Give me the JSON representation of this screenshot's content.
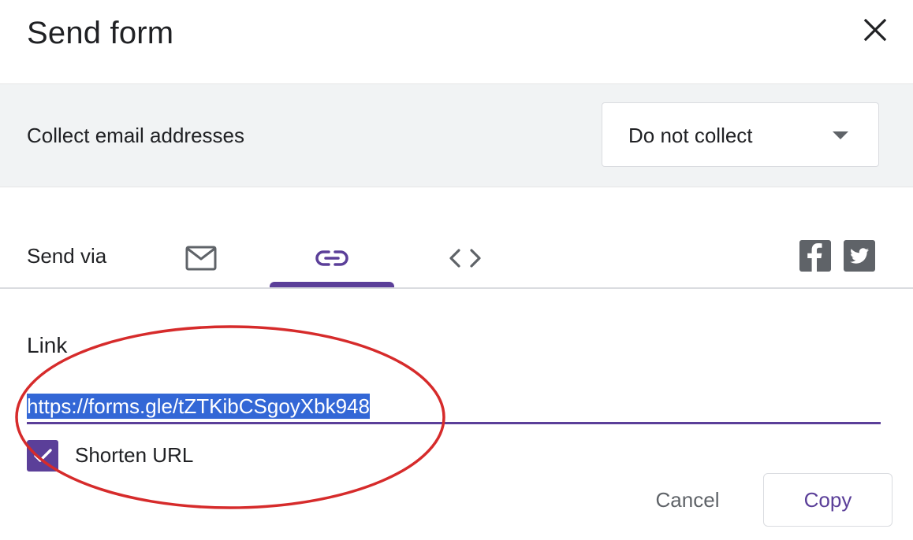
{
  "dialog": {
    "title": "Send form",
    "close_icon": "close-icon"
  },
  "collect": {
    "label": "Collect email addresses",
    "selected_value": "Do not collect"
  },
  "send_via": {
    "label": "Send via",
    "tabs": [
      {
        "icon": "mail-icon",
        "selected": false
      },
      {
        "icon": "link-icon",
        "selected": true
      },
      {
        "icon": "embed-code-icon",
        "selected": false
      }
    ],
    "share_icons": [
      "facebook-icon",
      "twitter-icon"
    ]
  },
  "link": {
    "heading": "Link",
    "url": "https://forms.gle/tZTKibCSgoyXbk948",
    "shorten_label": "Shorten URL",
    "shorten_checked": true
  },
  "actions": {
    "cancel_label": "Cancel",
    "copy_label": "Copy"
  },
  "colors": {
    "accent": "#5b3f99",
    "selection": "#3367d6",
    "annotation": "#d62b2b",
    "panel": "#f1f3f4"
  }
}
